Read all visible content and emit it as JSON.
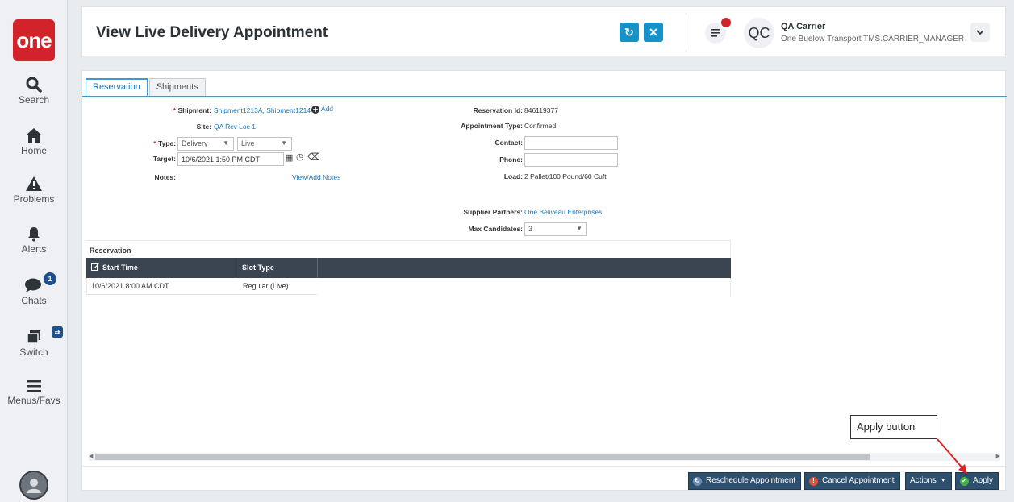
{
  "app": {
    "logo_text": "one",
    "brand_color": "#d2232a",
    "accent_color": "#1593c9"
  },
  "sidebar": {
    "items": [
      {
        "label": "Search",
        "icon": "search-icon"
      },
      {
        "label": "Home",
        "icon": "home-icon"
      },
      {
        "label": "Problems",
        "icon": "warning-icon"
      },
      {
        "label": "Alerts",
        "icon": "bell-icon"
      },
      {
        "label": "Chats",
        "icon": "chat-icon",
        "badge": "1"
      },
      {
        "label": "Switch",
        "icon": "switch-icon"
      },
      {
        "label": "Menus/Favs",
        "icon": "hamburger-icon"
      }
    ]
  },
  "header": {
    "title": "View Live Delivery Appointment",
    "user_initials": "QC",
    "user_name": "QA Carrier",
    "user_role": "One Buelow Transport TMS.CARRIER_MANAGER"
  },
  "tabs": [
    {
      "label": "Reservation",
      "active": true
    },
    {
      "label": "Shipments",
      "active": false
    }
  ],
  "form": {
    "shipment_label": "Shipment:",
    "shipment_value": "Shipment1213A, Shipment1214A",
    "add_label": "Add",
    "site_label": "Site:",
    "site_value": "QA Rcv Loc 1",
    "type_label": "Type:",
    "type_value": "Delivery",
    "mode_value": "Live",
    "target_label": "Target:",
    "target_value": "10/6/2021 1:50 PM CDT",
    "notes_label": "Notes:",
    "notes_link": "View/Add Notes",
    "reservation_id_label": "Reservation Id:",
    "reservation_id_value": "846119377",
    "appt_type_label": "Appointment Type:",
    "appt_type_value": "Confirmed",
    "contact_label": "Contact:",
    "contact_value": "",
    "phone_label": "Phone:",
    "phone_value": "",
    "load_label": "Load:",
    "load_value": "2 Pallet/100 Pound/60 Cuft",
    "supplier_label": "Supplier Partners:",
    "supplier_value": "One Beliveau Enterprises",
    "max_candidates_label": "Max Candidates:",
    "max_candidates_value": "3"
  },
  "reservation_grid": {
    "title": "Reservation",
    "columns": [
      "Start Time",
      "Slot Type"
    ],
    "rows": [
      [
        "10/6/2021 8:00 AM CDT",
        "Regular (Live)"
      ]
    ]
  },
  "footer": {
    "reschedule_label": "Reschedule Appointment",
    "cancel_label": "Cancel Appointment",
    "actions_label": "Actions",
    "apply_label": "Apply"
  },
  "annotation": {
    "callout_text": "Apply button"
  }
}
